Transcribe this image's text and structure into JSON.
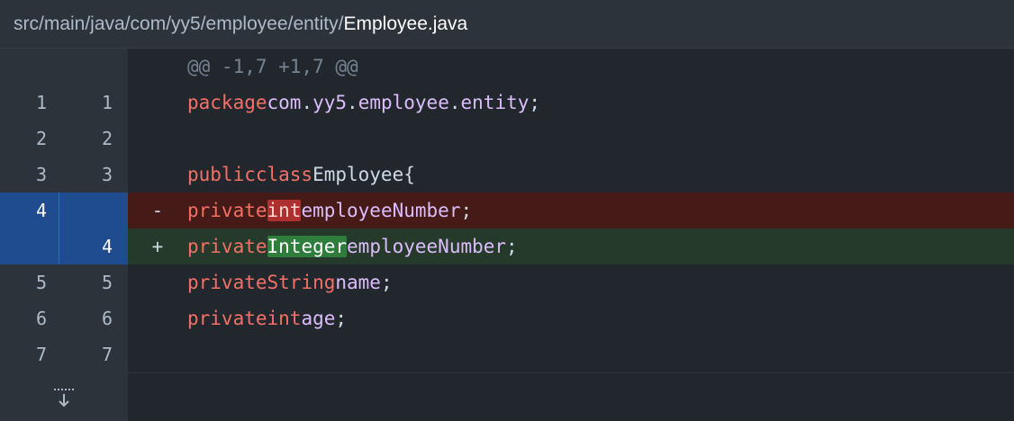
{
  "file": {
    "path_prefix": "src/main/java/com/yy5/employee/entity/",
    "file_name": "Employee.java"
  },
  "hunk_header": "@@ -1,7 +1,7 @@",
  "lines": {
    "l1": {
      "old": "1",
      "new": "1"
    },
    "l2": {
      "old": "2",
      "new": "2"
    },
    "l3": {
      "old": "3",
      "new": "3"
    },
    "l4del": {
      "old": "4",
      "marker": "-"
    },
    "l4add": {
      "new": "4",
      "marker": "+"
    },
    "l5": {
      "old": "5",
      "new": "5"
    },
    "l6": {
      "old": "6",
      "new": "6"
    },
    "l7": {
      "old": "7",
      "new": "7"
    }
  },
  "code": {
    "package_kw": "package",
    "pkg_com": "com",
    "pkg_yy5": "yy5",
    "pkg_employee": "employee",
    "pkg_entity": "entity",
    "public_kw": "public",
    "class_kw": "class",
    "class_name": "Employee",
    "private_kw": "private",
    "int_type": "int",
    "integer_type": "Integer",
    "string_type": "String",
    "field_employee_number": "employeeNumber",
    "field_name": "name",
    "field_age": "age",
    "dot": ".",
    "semicolon": ";",
    "brace_open": "{"
  },
  "colors": {
    "background": "#22272e",
    "deleted_line": "#461a16",
    "added_line": "#263a2b",
    "selected_gutter": "#1f4b8f",
    "selection_accent": "#2f81f7"
  },
  "icons": {
    "expand": "expand-down-icon"
  }
}
